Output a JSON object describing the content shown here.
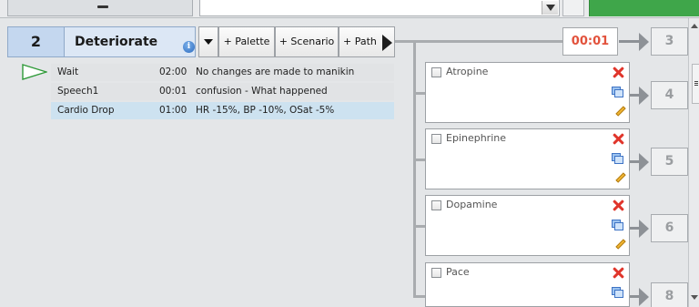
{
  "state": {
    "number": "2",
    "name": "Deteriorate",
    "info_icon": "info-icon"
  },
  "toolbar": {
    "menu_icon": "dropdown-arrow-icon",
    "palette_label": "+ Palette",
    "scenario_label": "+ Scenario",
    "path_label": "+ Path"
  },
  "events": [
    {
      "name": "Wait",
      "time": "02:00",
      "description": "No changes are made to manikin",
      "active": true
    },
    {
      "name": "Speech1",
      "time": "00:01",
      "description": "confusion - What happened",
      "active": false
    },
    {
      "name": "Cardio Drop",
      "time": "01:00",
      "description": "HR -15%, BP -10%, OSat -5%",
      "active": false,
      "selected": true
    }
  ],
  "timer": "00:01",
  "transitions": [
    {
      "target": "3"
    },
    {
      "target": "4"
    },
    {
      "target": "5"
    },
    {
      "target": "6"
    },
    {
      "target": "8"
    }
  ],
  "actions": [
    {
      "label": "Atropine",
      "checked": false
    },
    {
      "label": "Epinephrine",
      "checked": false
    },
    {
      "label": "Dopamine",
      "checked": false
    },
    {
      "label": "Pace",
      "checked": false
    }
  ],
  "colors": {
    "accent_green": "#3fa64a",
    "timer_red": "#e2523c",
    "delete_red": "#e0352b",
    "selected_row": "#cde2f0"
  }
}
